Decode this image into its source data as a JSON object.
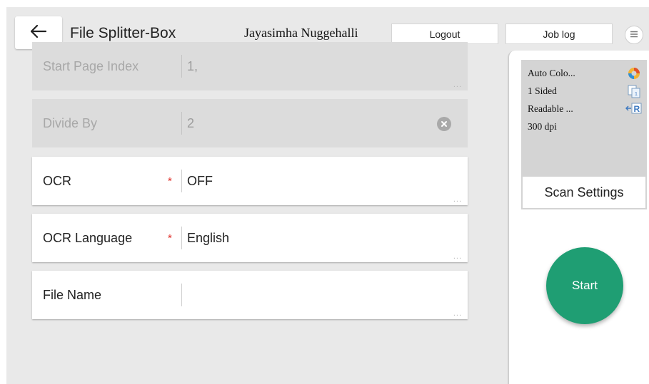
{
  "header": {
    "back_icon": "arrow-left-icon",
    "title": "File Splitter-Box",
    "user_name": "Jayasimha Nuggehalli",
    "logout_label": "Logout",
    "joblog_label": "Job log",
    "menu_icon": "hamburger-menu-icon"
  },
  "form": {
    "rows": [
      {
        "label": "Start Page Index",
        "value": "1,",
        "required": false,
        "disabled": true
      },
      {
        "label": "Divide By",
        "value": "2",
        "required": false,
        "disabled": true,
        "clear_icon": "clear-circle-icon"
      },
      {
        "label": "OCR",
        "value": "OFF",
        "required": true,
        "disabled": false
      },
      {
        "label": "OCR Language",
        "value": "English",
        "required": true,
        "disabled": false
      },
      {
        "label": "File Name",
        "value": "",
        "required": false,
        "disabled": false
      }
    ],
    "required_marker": "*",
    "more_indicator": "..."
  },
  "scan_settings": {
    "lines": [
      "Auto Colo...",
      "1 Sided",
      "Readable ...",
      "300 dpi"
    ],
    "icons": [
      "auto-color-icon",
      "one-sided-icon",
      "readable-icon"
    ],
    "button_label": "Scan Settings"
  },
  "start_label": "Start",
  "colors": {
    "start_button": "#1f9e73",
    "required": "#e0302a",
    "background": "#e9e9e9"
  }
}
